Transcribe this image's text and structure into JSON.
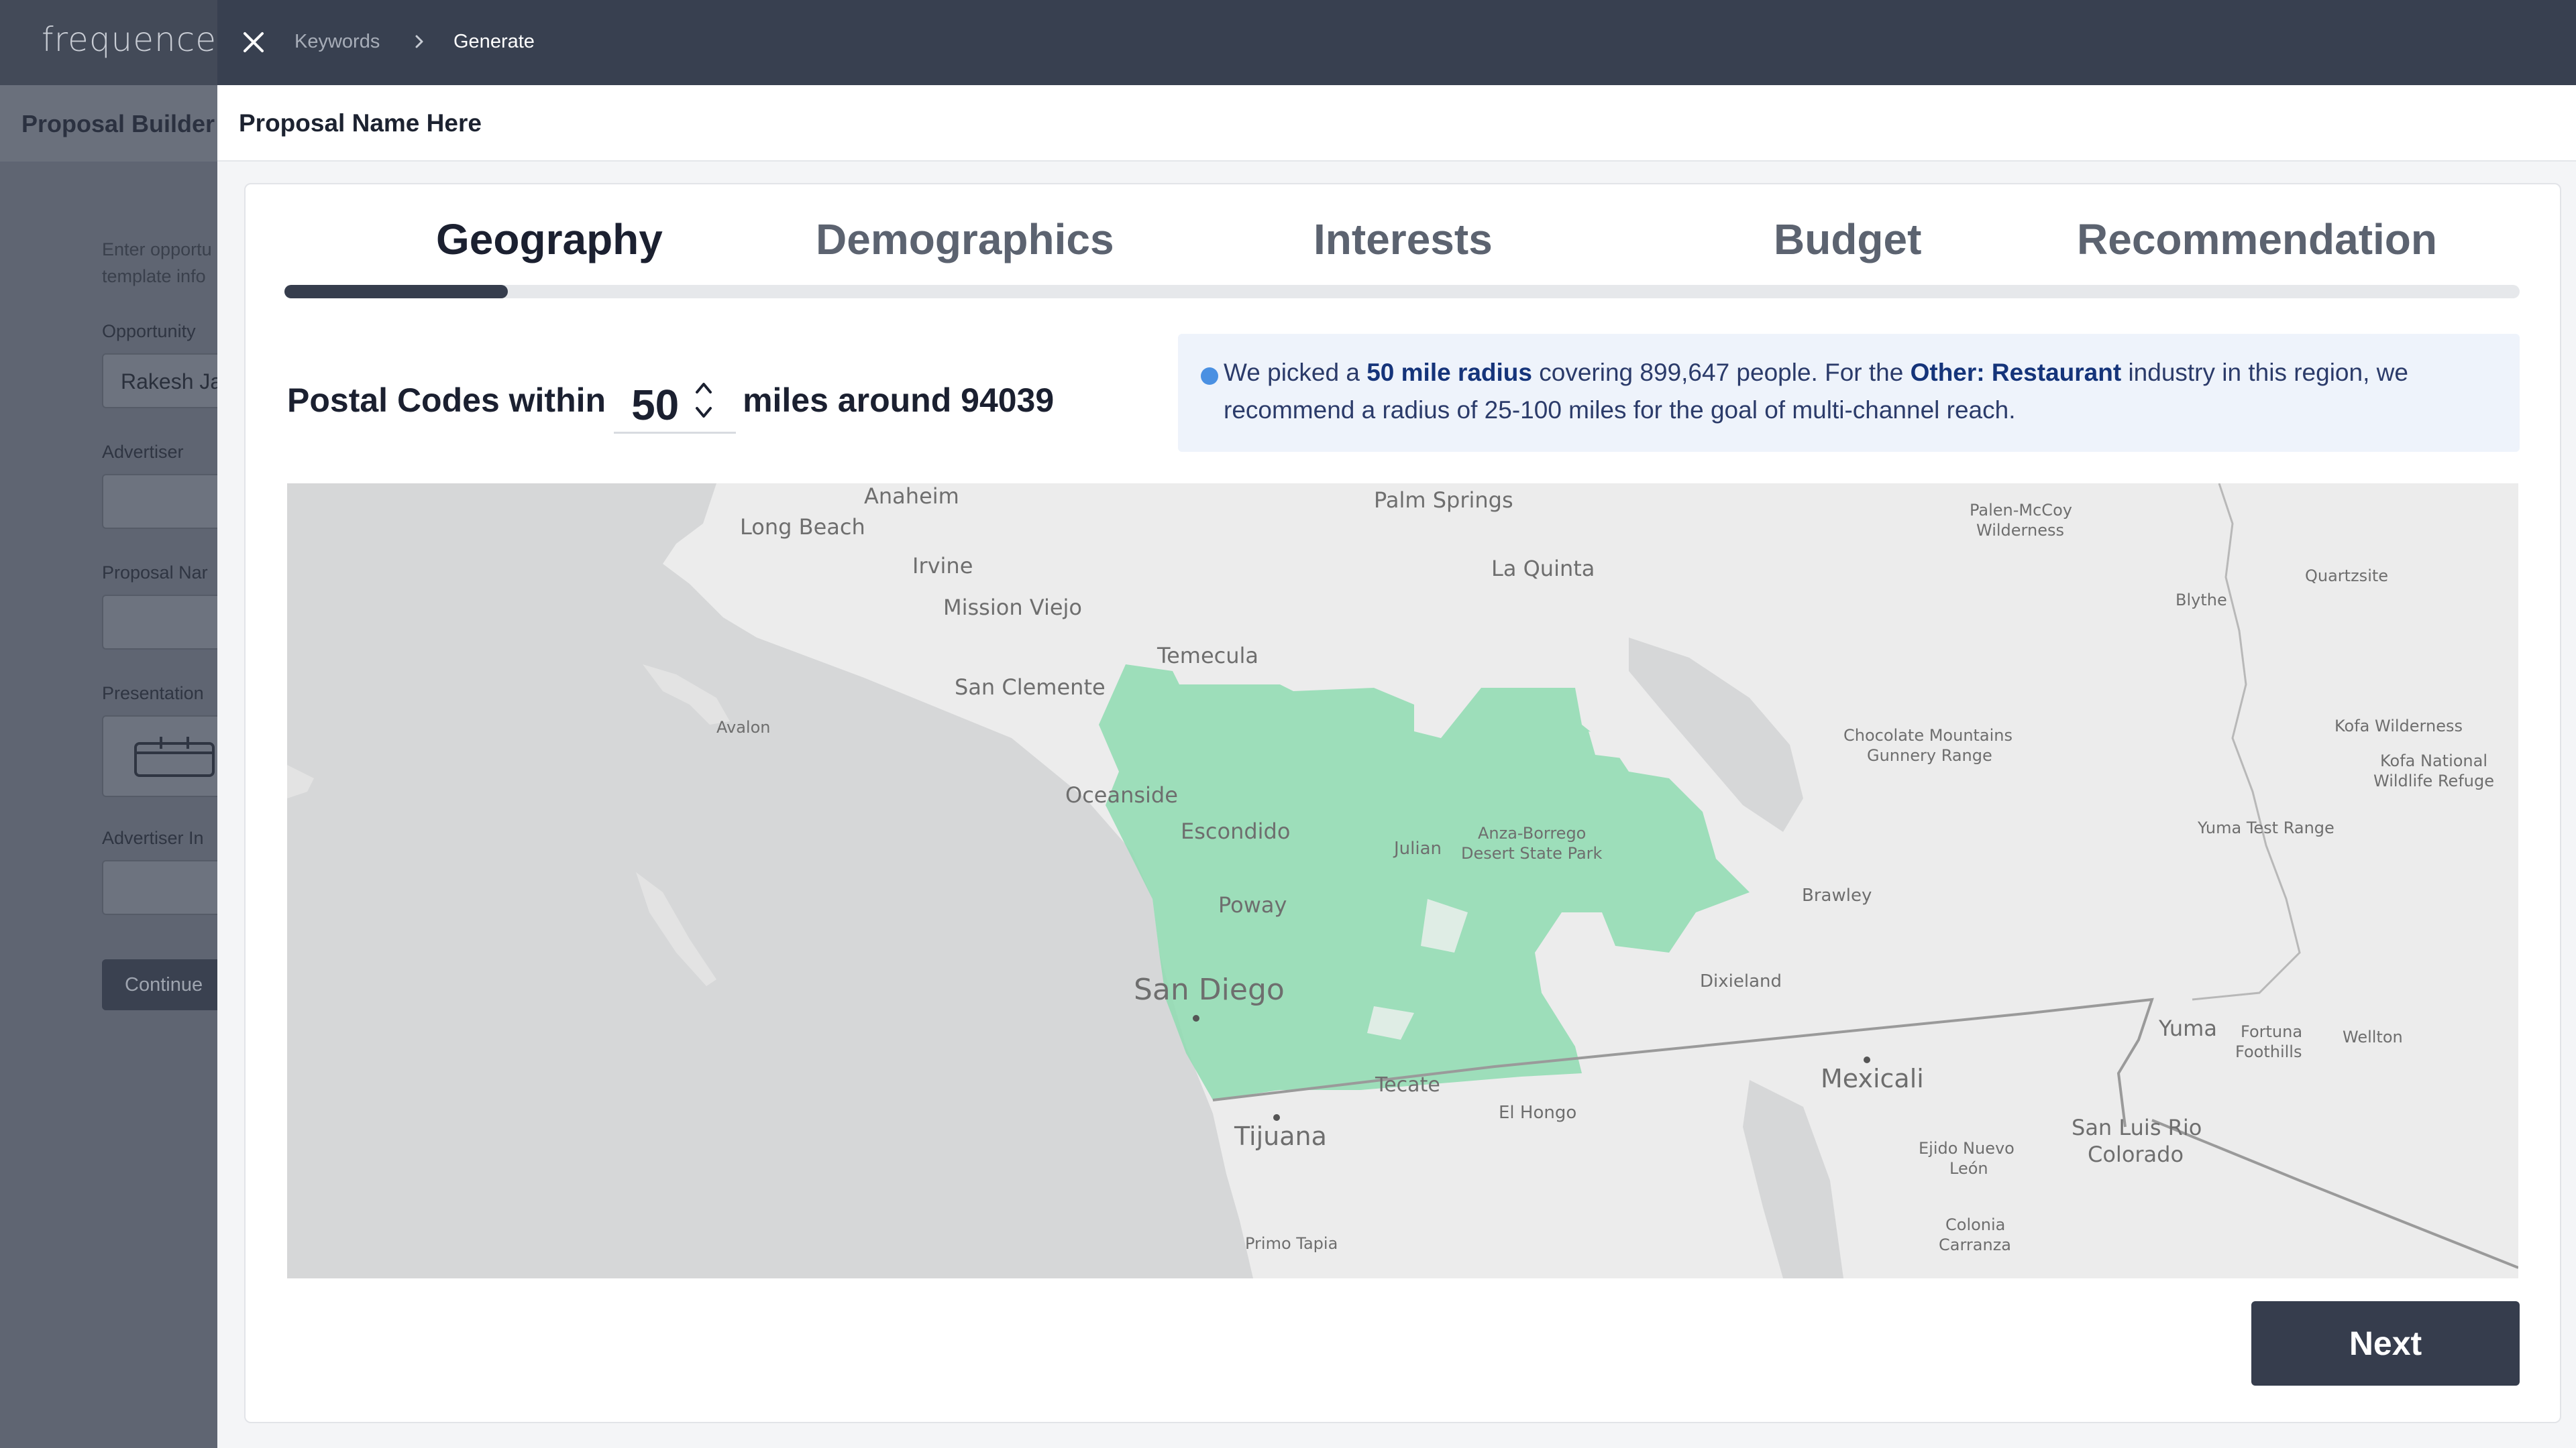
{
  "topbar": {
    "logo": "frequence",
    "breadcrumb": [
      "Keywords",
      "Generate"
    ]
  },
  "builder": {
    "title": "Proposal Builder",
    "help_line1": "Enter opportu",
    "help_line2": "template info",
    "fields": [
      {
        "label": "Opportunity",
        "value": "Rakesh Ja"
      },
      {
        "label": "Advertiser",
        "value": ""
      },
      {
        "label": "Proposal Nar",
        "value": ""
      },
      {
        "label": "Presentation",
        "value": ""
      },
      {
        "label": "Advertiser In",
        "value": ""
      }
    ],
    "continue_label": "Continue"
  },
  "proposal": {
    "name": "Proposal Name Here"
  },
  "steps": {
    "items": [
      {
        "label": "Geography",
        "active": true
      },
      {
        "label": "Demographics",
        "active": false
      },
      {
        "label": "Interests",
        "active": false
      },
      {
        "label": "Budget",
        "active": false
      },
      {
        "label": "Recommendation",
        "active": false
      }
    ],
    "progress": 0.1
  },
  "geography": {
    "prefix": "Postal Codes within",
    "radius": "50",
    "suffix": "miles around 94039"
  },
  "info": {
    "t1": "We picked a ",
    "b1": "50 mile radius",
    "t2": " covering 899,647 people. For the ",
    "b2": "Other: Restaurant",
    "t3": " industry in this region, we recommend a radius of 25-100 miles for the goal of multi-channel reach."
  },
  "map_labels": [
    "Anaheim",
    "Long Beach",
    "Irvine",
    "Mission Viejo",
    "San Clemente",
    "Temecula",
    "Palm Springs",
    "La Quinta",
    "Palen-McCoy",
    "Wilderness",
    "Blythe",
    "Quartzsite",
    "Avalon",
    "Oceanside",
    "Escondido",
    "Julian",
    "Anza-Borrego",
    "Desert State Park",
    "Poway",
    "Chocolate Mountains",
    "Gunnery Range",
    "Kofa Wilderness",
    "Kofa National",
    "Wildlife Refuge",
    "Yuma Test Range",
    "Brawley",
    "San Diego",
    "Dixieland",
    "Yuma",
    "Fortuna",
    "Foothills",
    "Wellton",
    "Tecate",
    "El Hongo",
    "Mexicali",
    "Tijuana",
    "San Luis Rio",
    "Colorado",
    "Ejido Nuevo",
    "León",
    "Colonia",
    "Carranza",
    "Primo Tapia"
  ],
  "next_label": "Next",
  "colors": {
    "topbar": "#384050",
    "accent_dark": "#363d4d",
    "coverage": "#8fdcb2",
    "info_bg": "#eef3fb",
    "info_dot": "#4a90e2"
  },
  "icons": [
    "close-icon",
    "chevron-right-icon",
    "chevron-up-icon",
    "chevron-down-icon",
    "info-dot-icon"
  ]
}
